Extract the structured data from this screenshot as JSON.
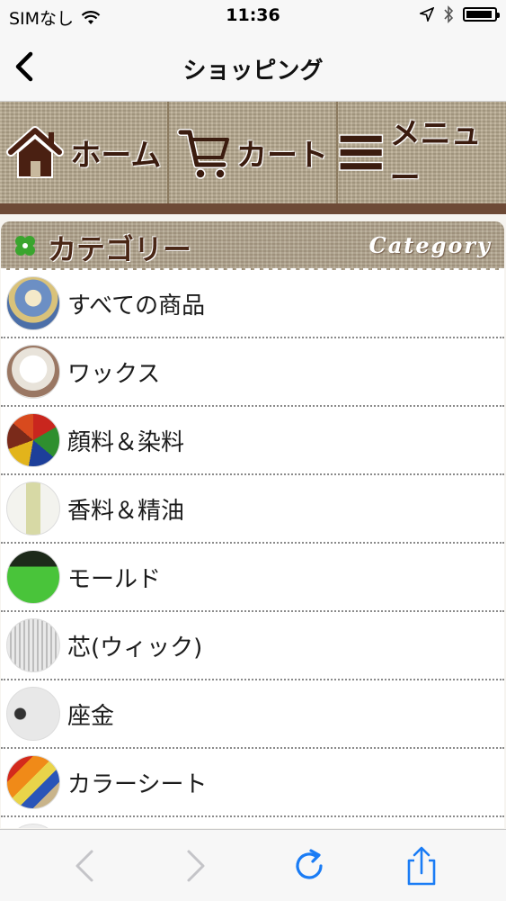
{
  "status_bar": {
    "carrier": "SIMなし",
    "time": "11:36",
    "icons": [
      "wifi-icon",
      "location-icon",
      "bluetooth-icon",
      "battery-icon"
    ]
  },
  "nav": {
    "title": "ショッピング",
    "back_icon": "chevron-left-icon"
  },
  "menu": {
    "home_label": "ホーム",
    "cart_label": "カート",
    "menu_label": "メニュー"
  },
  "category_header": {
    "title": "カテゴリー",
    "script": "Category"
  },
  "categories": [
    {
      "label": "すべての商品"
    },
    {
      "label": "ワックス"
    },
    {
      "label": "顔料＆染料"
    },
    {
      "label": "香料＆精油"
    },
    {
      "label": "モールド"
    },
    {
      "label": "芯(ウィック)"
    },
    {
      "label": "座金"
    },
    {
      "label": "カラーシート"
    }
  ],
  "toolbar": {
    "icons": [
      "back-arrow-icon",
      "forward-arrow-icon",
      "reload-icon",
      "share-icon"
    ]
  },
  "colors": {
    "burlap": "#b7a98f",
    "brown_text": "#3b1c0f",
    "accent_blue": "#1a7cf5",
    "clover_green": "#3aa52e"
  }
}
